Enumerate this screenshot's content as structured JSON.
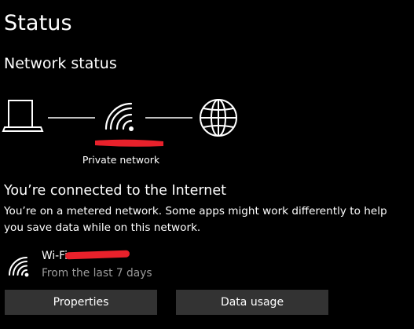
{
  "page": {
    "title": "Status"
  },
  "network_status": {
    "heading": "Network status",
    "diagram": {
      "device_icon": "laptop-icon",
      "network_icon": "wifi-icon",
      "internet_icon": "globe-icon",
      "network_label": "Private network"
    },
    "connection_title": "You’re connected to the Internet",
    "connection_description": "You’re on a metered network. Some apps might work differently to help you save data while on this network."
  },
  "adapter": {
    "icon": "wifi-icon",
    "name": "Wi-Fi",
    "usage_period": "From the last 7 days"
  },
  "buttons": {
    "properties": "Properties",
    "data_usage": "Data usage"
  },
  "colors": {
    "background": "#000000",
    "text": "#ffffff",
    "secondary_text": "#9a9a9a",
    "button_background": "#333333",
    "redaction": "#e8212b"
  }
}
